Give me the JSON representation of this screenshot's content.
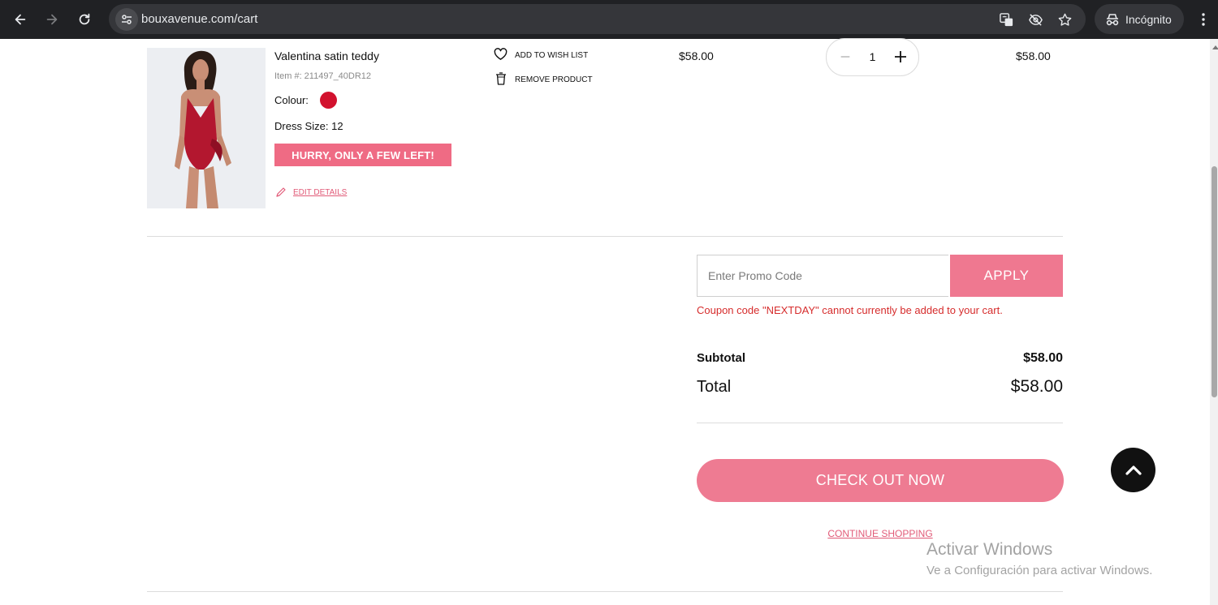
{
  "browser": {
    "url": "bouxavenue.com/cart",
    "profile_label": "Incógnito"
  },
  "cart_item": {
    "name": "Valentina satin teddy",
    "sku": "Item #: 211497_40DR12",
    "colour_label": "Colour:",
    "colour_hex": "#d2122e",
    "size_label": "Dress Size:",
    "size_value": "12",
    "stock_badge": "HURRY, ONLY A FEW LEFT!",
    "edit_label": "EDIT DETAILS",
    "wishlist_label": "ADD TO WISH LIST",
    "remove_label": "REMOVE PRODUCT",
    "unit_price": "$58.00",
    "quantity": "1",
    "line_total": "$58.00"
  },
  "promo": {
    "placeholder": "Enter Promo Code",
    "apply_label": "APPLY",
    "error": "Coupon code \"NEXTDAY\" cannot currently be added to your cart."
  },
  "summary": {
    "subtotal_label": "Subtotal",
    "subtotal_value": "$58.00",
    "total_label": "Total",
    "total_value": "$58.00"
  },
  "actions": {
    "checkout_label": "CHECK OUT NOW",
    "continue_label": "CONTINUE SHOPPING"
  },
  "watermark": {
    "title": "Activar Windows",
    "subtitle": "Ve a Configuración para activar Windows."
  },
  "colors": {
    "accent_pink": "#ef7890",
    "badge_pink": "#ef6b84",
    "link_pink": "#e15b78",
    "error_red": "#d62c2c",
    "chrome_dark": "#202124"
  }
}
